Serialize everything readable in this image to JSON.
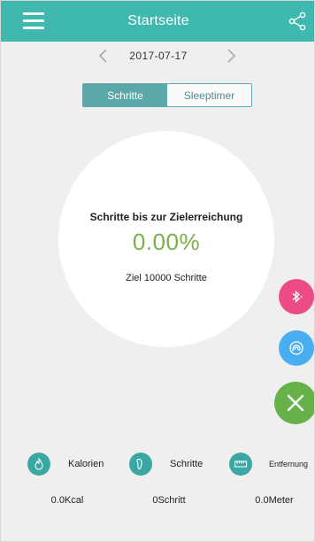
{
  "header": {
    "title": "Startseite",
    "menu_icon": "menu-icon",
    "share_icon": "share-icon"
  },
  "date_nav": {
    "date": "2017-07-17",
    "prev_icon": "chevron-left-icon",
    "next_icon": "chevron-right-icon"
  },
  "tabs": [
    {
      "label": "Schritte",
      "active": true
    },
    {
      "label": "Sleeptimer",
      "active": false
    }
  ],
  "progress": {
    "title": "Schritte bis zur Zielerreichung",
    "percent_text": "0.00%",
    "goal_text": "Ziel 10000 Schritte"
  },
  "fabs": [
    {
      "name": "bluetooth-button",
      "icon": "bluetooth-icon",
      "color": "#ec4c86"
    },
    {
      "name": "nfc-button",
      "icon": "nfc-icon",
      "color": "#49aef0"
    },
    {
      "name": "close-button",
      "icon": "close-icon",
      "color": "#67b14a"
    }
  ],
  "stats": [
    {
      "icon": "flame-icon",
      "label": "Kalorien",
      "value": "0.0Kcal"
    },
    {
      "icon": "footprint-icon",
      "label": "Schritte",
      "value": "0Schritt"
    },
    {
      "icon": "ruler-icon",
      "label": "Entfernung",
      "value": "0.0Meter"
    }
  ],
  "colors": {
    "header": "#3fb9b0",
    "accent": "#5aa8a7",
    "progress_text": "#78b04a",
    "stat_icon": "#3ba7a3",
    "background": "#efefef"
  }
}
